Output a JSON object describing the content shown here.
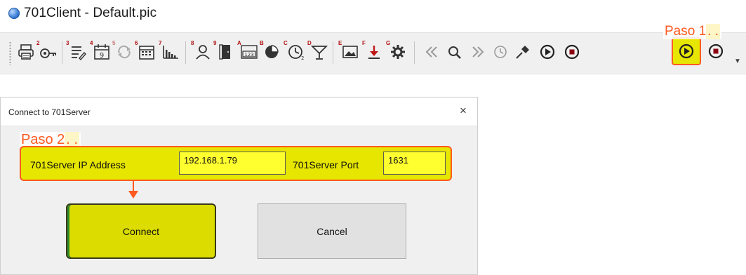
{
  "app": {
    "title": "701Client - Default.pic"
  },
  "toolbar": {
    "buttons": [
      {
        "name": "print",
        "num": "",
        "icon": "printer-icon"
      },
      {
        "name": "login",
        "num": "2",
        "icon": "key-icon"
      },
      {
        "name": "checklist",
        "num": "3",
        "icon": "checklist-icon"
      },
      {
        "name": "calendar-9",
        "num": "4",
        "icon": "calendar-icon"
      },
      {
        "name": "sync",
        "num": "5",
        "icon": "sync-icon"
      },
      {
        "name": "schedule",
        "num": "6",
        "icon": "schedule-icon"
      },
      {
        "name": "bar-chart",
        "num": "7",
        "icon": "bar-chart-icon"
      },
      {
        "name": "users",
        "num": "8",
        "icon": "users-icon"
      },
      {
        "name": "door",
        "num": "9",
        "icon": "door-icon"
      },
      {
        "name": "counter",
        "num": "A",
        "icon": "counter-icon"
      },
      {
        "name": "pie",
        "num": "B",
        "icon": "pie-chart-icon"
      },
      {
        "name": "clock",
        "num": "C",
        "icon": "clock-icon"
      },
      {
        "name": "cocktail",
        "num": "D",
        "icon": "cocktail-icon"
      },
      {
        "name": "image",
        "num": "E",
        "icon": "image-icon"
      },
      {
        "name": "download",
        "num": "F",
        "icon": "download-icon"
      },
      {
        "name": "settings",
        "num": "G",
        "icon": "gear-icon"
      },
      {
        "name": "rewind",
        "num": "",
        "icon": "rewind-icon"
      },
      {
        "name": "search",
        "num": "",
        "icon": "search-icon"
      },
      {
        "name": "fast-forward",
        "num": "",
        "icon": "fast-forward-icon"
      },
      {
        "name": "history",
        "num": "",
        "icon": "history-icon"
      },
      {
        "name": "pin",
        "num": "",
        "icon": "pin-icon"
      },
      {
        "name": "run",
        "num": "",
        "icon": "play-icon"
      },
      {
        "name": "stop",
        "num": "",
        "icon": "stop-icon"
      }
    ]
  },
  "annotations": {
    "step1": "Paso 1",
    "step1_dots": ". .",
    "step2": "Paso 2",
    "step2_dots": ". ."
  },
  "dialog": {
    "title": "Connect to 701Server",
    "close_glyph": "×",
    "ip_label": "701Server IP Address",
    "ip_value": "192.168.1.79",
    "port_label": "701Server Port",
    "port_value": "1631",
    "connect_label": "Connect",
    "cancel_label": "Cancel"
  },
  "colors": {
    "highlight": "#e6e600",
    "annotation": "#ff5a1f"
  }
}
